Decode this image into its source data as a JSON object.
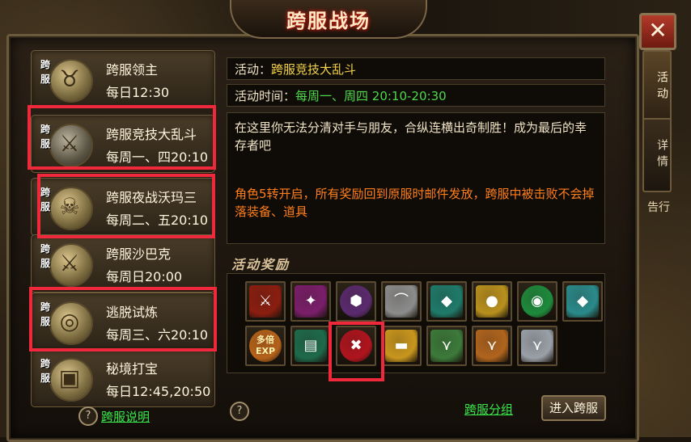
{
  "title": "跨服战场",
  "close_label": "✕",
  "side_tabs": [
    {
      "label": "活动",
      "active": true
    },
    {
      "label": "详情",
      "active": false
    }
  ],
  "side_scrap_text": "告行",
  "events": [
    {
      "tag": "跨服",
      "name": "跨服领主",
      "time": "每日12:30",
      "icon": "bull-head-icon",
      "glyph": "♉",
      "highlighted": false
    },
    {
      "tag": "跨服",
      "name": "跨服竞技大乱斗",
      "time": "每周一、四20:10",
      "icon": "crossed-swords-icon",
      "glyph": "⚔",
      "highlighted": true
    },
    {
      "tag": "跨服",
      "name": "跨服夜战沃玛三",
      "time": "每周二、五20:10",
      "icon": "demon-head-icon",
      "glyph": "☠",
      "highlighted": true
    },
    {
      "tag": "跨服",
      "name": "跨服沙巴克",
      "time": "每周日20:00",
      "icon": "crossed-swords-icon",
      "glyph": "⚔",
      "highlighted": false
    },
    {
      "tag": "跨服",
      "name": "逃脱试炼",
      "time": "每周三、六20:10",
      "icon": "spiral-vortex-icon",
      "glyph": "◎",
      "highlighted": true
    },
    {
      "tag": "跨服",
      "name": "秘境打宝",
      "time": "每日12:45,20:50",
      "icon": "treasure-chest-icon",
      "glyph": "▣",
      "highlighted": false
    }
  ],
  "help_left_label": "跨服说明",
  "help_symbol": "?",
  "activity": {
    "name_label": "活动：",
    "name_value": "跨服竞技大乱斗",
    "time_label": "活动时间：",
    "time_value": "每周一、周四 20:10-20:30",
    "description": "在这里你无法分清对手与朋友，合纵连横出奇制胜！成为最后的幸存者吧",
    "notice": "角色5转开启，所有奖励回到原服时邮件发放，跨服中被击败不会掉落装备、道具"
  },
  "rewards_title": "活动奖励",
  "rewards": [
    {
      "icon": "red-blade-icon",
      "glyph": "⚔",
      "bg": "#8a1e10"
    },
    {
      "icon": "purple-sword-icon",
      "glyph": "✦",
      "bg": "#7a1e6a"
    },
    {
      "icon": "purple-helmet-icon",
      "glyph": "⬢",
      "bg": "#5a2a6e"
    },
    {
      "icon": "silver-ingot-icon",
      "glyph": "⌒",
      "bg": "#8c8c8c"
    },
    {
      "icon": "teal-crystal-icon",
      "glyph": "◆",
      "bg": "#1f7a6a"
    },
    {
      "icon": "gold-coins-icon",
      "glyph": "●",
      "bg": "#b8901e"
    },
    {
      "icon": "green-orb-icon",
      "glyph": "◉",
      "bg": "#1e8a3c"
    },
    {
      "icon": "teal-shards-icon",
      "glyph": "◆",
      "bg": "#2a8a8a"
    },
    {
      "icon": "exp-multiplier-icon",
      "glyph": "多倍 EXP",
      "bg": "#b5621a"
    },
    {
      "icon": "green-skill-book-icon",
      "glyph": "▤",
      "bg": "#1e6a4a"
    },
    {
      "icon": "red-token-icon",
      "glyph": "✖",
      "bg": "#b0141e"
    },
    {
      "icon": "gold-ingot-icon",
      "glyph": "▬",
      "bg": "#c8961e"
    },
    {
      "icon": "green-cape-icon",
      "glyph": "⋎",
      "bg": "#3c7a3a"
    },
    {
      "icon": "orange-cape-icon",
      "glyph": "⋎",
      "bg": "#b0641e"
    },
    {
      "icon": "white-cloak-icon",
      "glyph": "⋎",
      "bg": "#9aa0a8"
    }
  ],
  "highlighted_reward_index": 10,
  "group_link_label": "跨服分组",
  "enter_button_label": "进入跨服"
}
